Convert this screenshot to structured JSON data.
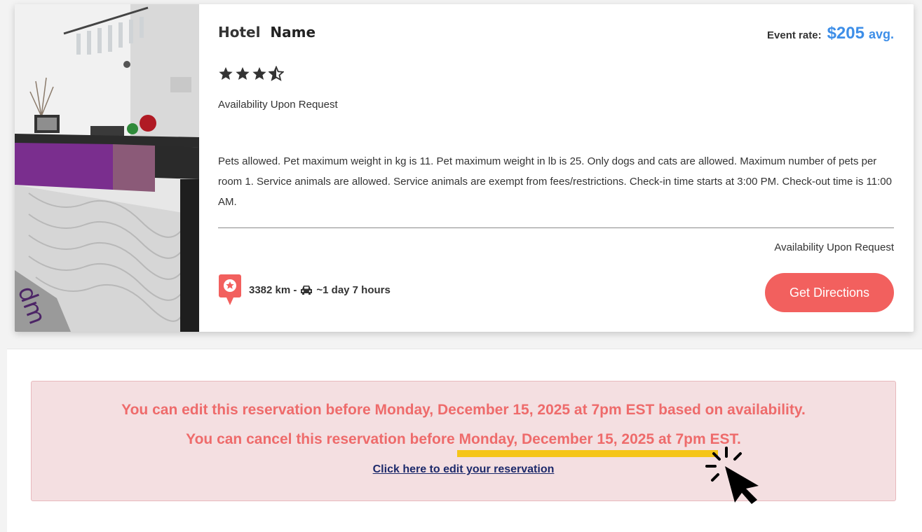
{
  "hotel": {
    "name_first": "Hotel",
    "name_second": "Name",
    "star_rating": 3.5,
    "availability_top": "Availability Upon Request",
    "description": "Pets allowed. Pet maximum weight in kg is 11. Pet maximum weight in lb is 25. Only dogs and cats are allowed. Maximum number of pets per room 1. Service animals are allowed. Service animals are exempt from fees/restrictions. Check-in time starts at 3:00 PM. Check-out time is 11:00 AM.",
    "availability_bottom": "Availability Upon Request",
    "rate_label": "Event rate:",
    "rate_value": "$205",
    "rate_suffix": "avg.",
    "distance_km": "3382 km -",
    "drive_time": "~1 day 7 hours",
    "directions_label": "Get Directions"
  },
  "notice": {
    "edit_line": "You can edit this reservation before Monday, December 15, 2025 at 7pm EST based on availability.",
    "cancel_line": "You can cancel this reservation before Monday, December 15, 2025 at 7pm EST.",
    "edit_link": "Click here to edit your reservation"
  },
  "colors": {
    "accent_blue": "#3d8ee8",
    "button_red": "#f2605e",
    "alert_bg": "#f4dfe1",
    "alert_text": "#ee6b6b",
    "highlight": "#f5c518"
  },
  "icons": {
    "star": "star-icon",
    "half_star": "half-star-icon",
    "map_pin": "map-pin-icon",
    "car": "car-icon",
    "cursor": "click-cursor-icon"
  }
}
